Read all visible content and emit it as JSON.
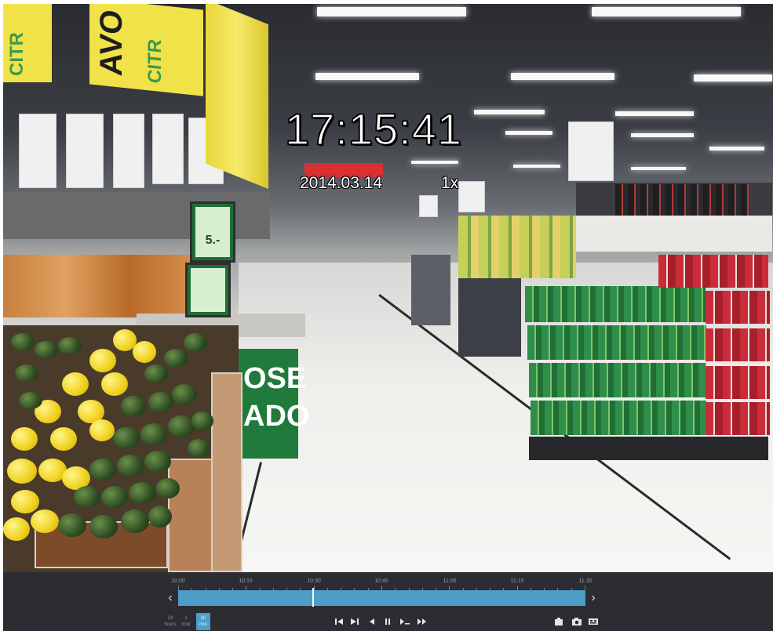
{
  "osd": {
    "time": "17:15:41",
    "date": "2014.03.14",
    "speed": "1x"
  },
  "scene": {
    "banner_left_text": "CITR",
    "banner_main_text": "AVO",
    "banner_main_sub": "CITR",
    "price_sign_text": "5.-",
    "green_sign_lines": [
      "OSE",
      "ADO"
    ]
  },
  "timeline": {
    "tick_labels": [
      "10:00",
      "10:15",
      "10:30",
      "10:45",
      "11:00",
      "11:15",
      "11:30"
    ],
    "playhead_position": 0.33,
    "prev_label": "‹",
    "next_label": "›",
    "zoom_options": [
      {
        "top": "24",
        "bottom": "hours"
      },
      {
        "top": "1",
        "bottom": "hour"
      },
      {
        "top": "30",
        "bottom": "min"
      }
    ],
    "zoom_active_index": 2
  },
  "controls": {
    "playback": [
      "skip-start-icon",
      "skip-end-icon",
      "step-back-icon",
      "pause-icon",
      "slow-icon",
      "fast-icon"
    ],
    "tools": [
      "export-icon",
      "snapshot-icon",
      "multi-view-icon"
    ]
  },
  "colors": {
    "timeline_fill": "#4d9dc9",
    "bar_background": "#2b2d32",
    "osd_text": "#ffffff"
  }
}
